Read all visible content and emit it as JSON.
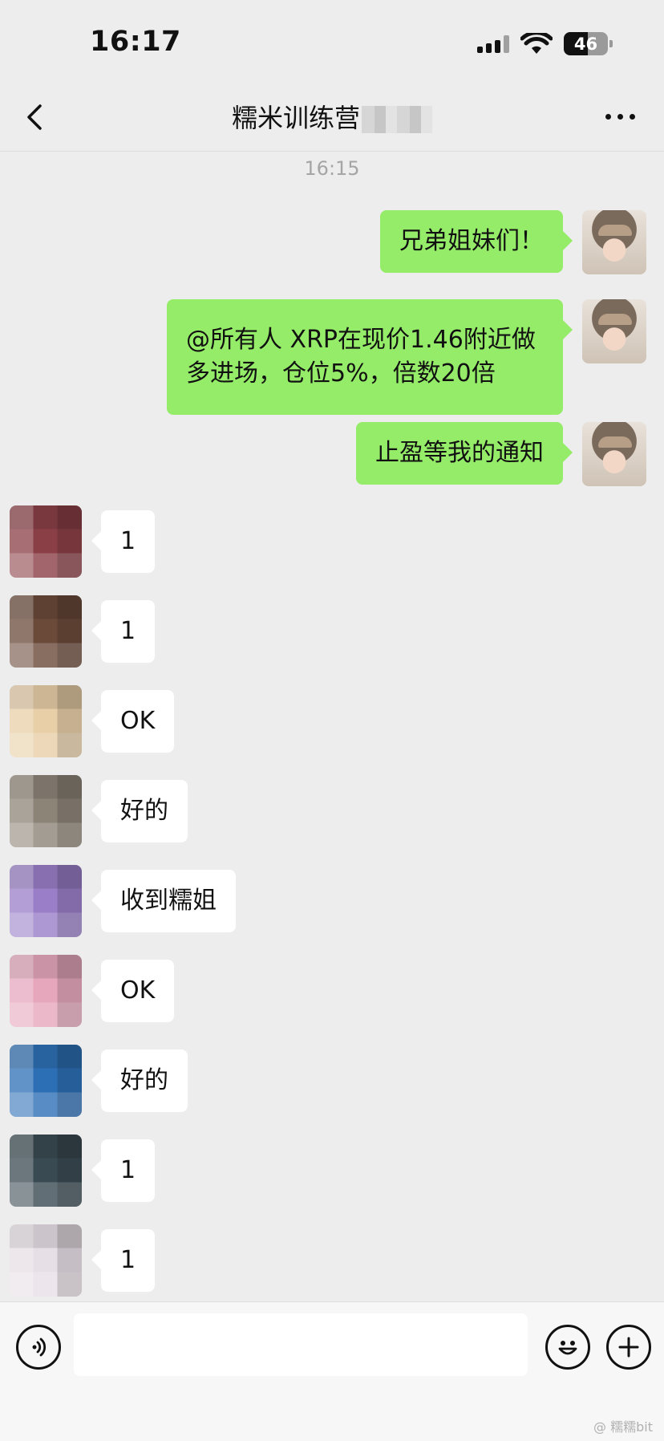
{
  "status": {
    "time": "16:17",
    "battery": "46"
  },
  "nav": {
    "title": "糯米训练营"
  },
  "timestamp": "16:15",
  "outgoing": [
    {
      "text": "兄弟姐妹们！"
    },
    {
      "text": "@所有人 XRP在现价1.46附近做多进场，仓位5%，倍数20倍"
    },
    {
      "text": "止盈等我的通知"
    }
  ],
  "incoming": [
    {
      "text": "1",
      "avatar_color": "#8a3f46"
    },
    {
      "text": "1",
      "avatar_color": "#6b4a3a"
    },
    {
      "text": "OK",
      "avatar_color": "#e8cfa8"
    },
    {
      "text": "好的",
      "avatar_color": "#8d8478"
    },
    {
      "text": "收到糯姐",
      "avatar_color": "#9a7ec8"
    },
    {
      "text": "OK",
      "avatar_color": "#e6a7bd"
    },
    {
      "text": "好的",
      "avatar_color": "#2d6fb5"
    },
    {
      "text": "1",
      "avatar_color": "#3a4a52"
    },
    {
      "text": "1",
      "avatar_color": "#e7dfe6"
    }
  ],
  "input": {
    "placeholder": ""
  },
  "watermark": "@ 糯糯bit"
}
